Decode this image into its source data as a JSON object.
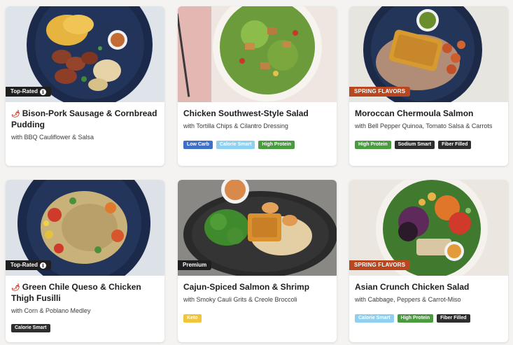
{
  "colors": {
    "background": "#f4f3f1",
    "tag_dark": "#1f1f1f",
    "tag_orange": "#b8461f",
    "low_carb": "#3f6fc7",
    "calorie_smart_light": "#8fd0f0",
    "high_protein": "#4a9a3f",
    "sodium_smart": "#2e2e2e",
    "fiber_filled": "#2e2e2e",
    "calorie_smart_dark": "#2e2e2e",
    "keto": "#f0c53c"
  },
  "meals": [
    {
      "tag": "Top-Rated",
      "tag_icon": "info-icon",
      "spicy_icon": "chili-pepper-icon",
      "title": "Bison-Pork Sausage & Cornbread Pudding",
      "subtitle": "with BBQ Cauliflower & Salsa",
      "badges": []
    },
    {
      "tag": "",
      "title": "Chicken Southwest-Style Salad",
      "subtitle": "with Tortilla Chips & Cilantro Dressing",
      "badges": [
        "Low Carb",
        "Calorie Smart",
        "High Protein"
      ]
    },
    {
      "tag": "SPRING FLAVORS",
      "title": "Moroccan Chermoula Salmon",
      "subtitle": "with Bell Pepper Quinoa, Tomato Salsa & Carrots",
      "badges": [
        "High Protein",
        "Sodium Smart",
        "Fiber Filled"
      ]
    },
    {
      "tag": "Top-Rated",
      "tag_icon": "info-icon",
      "spicy_icon": "chili-pepper-icon",
      "title": "Green Chile Queso & Chicken Thigh Fusilli",
      "subtitle": "with Corn & Poblano Medley",
      "badges": [
        "Calorie Smart"
      ]
    },
    {
      "tag": "Premium",
      "title": "Cajun-Spiced Salmon & Shrimp",
      "subtitle": "with Smoky Cauli Grits & Creole Broccoli",
      "badges": [
        "Keto"
      ]
    },
    {
      "tag": "SPRING FLAVORS",
      "title": "Asian Crunch Chicken Salad",
      "subtitle": "with Cabbage, Peppers & Carrot-Miso",
      "badges": [
        "Calorie Smart",
        "High Protein",
        "Fiber Filled"
      ]
    }
  ]
}
